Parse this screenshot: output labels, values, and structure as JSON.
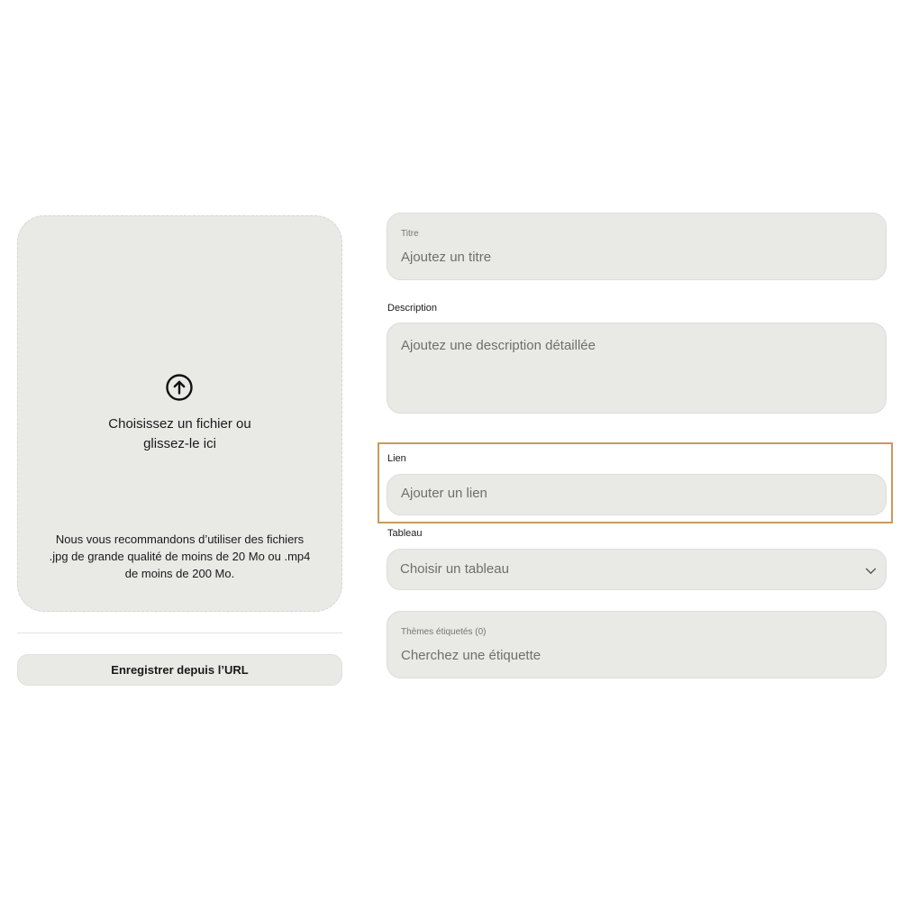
{
  "upload": {
    "icon": "upload-arrow-icon",
    "title_line1": "Choisissez un fichier ou",
    "title_line2": "glissez-le ici",
    "hint_line1": "Nous vous recommandons d’utiliser des fichiers",
    "hint_line2": ".jpg de grande qualité de moins de 20 Mo ou .mp4",
    "hint_line3": "de moins de 200 Mo.",
    "save_from_url_label": "Enregistrer depuis l’URL"
  },
  "form": {
    "title": {
      "label": "Titre",
      "placeholder": "Ajoutez un titre",
      "value": ""
    },
    "description": {
      "label": "Description",
      "placeholder": "Ajoutez une description détaillée",
      "value": ""
    },
    "link": {
      "label": "Lien",
      "placeholder": "Ajouter un lien",
      "value": ""
    },
    "board": {
      "label": "Tableau",
      "selected": "Choisir un tableau",
      "icon": "chevron-down-icon"
    },
    "tags": {
      "label": "Thèmes étiquetés (0)",
      "placeholder": "Cherchez une étiquette",
      "value": ""
    }
  },
  "colors": {
    "field_bg": "#e9e9e6",
    "highlight": "#c99b5b"
  }
}
